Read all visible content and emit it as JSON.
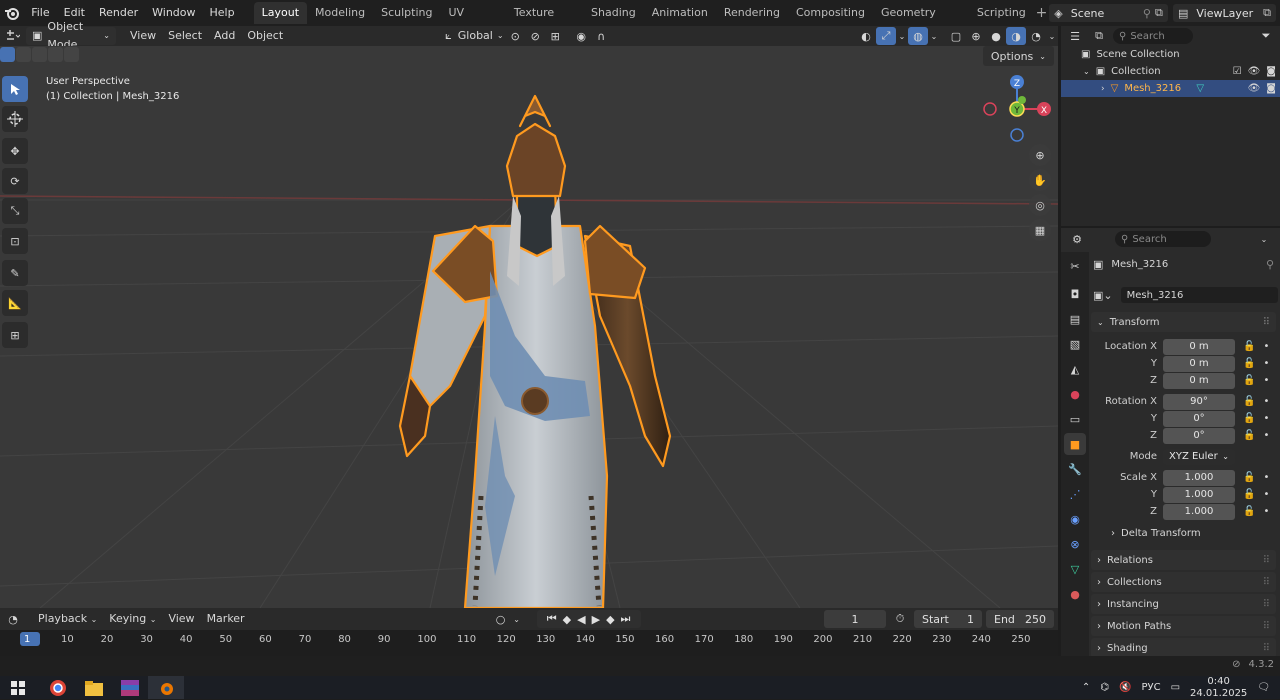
{
  "topbar": {
    "menus": [
      "File",
      "Edit",
      "Render",
      "Window",
      "Help"
    ],
    "workspaces": [
      "Layout",
      "Modeling",
      "Sculpting",
      "UV Editing",
      "Texture Paint",
      "Shading",
      "Animation",
      "Rendering",
      "Compositing",
      "Geometry Nodes",
      "Scripting"
    ],
    "active_workspace": "Layout",
    "scene": "Scene",
    "view_layer": "ViewLayer"
  },
  "viewport_header": {
    "mode": "Object Mode",
    "menus": [
      "View",
      "Select",
      "Add",
      "Object"
    ],
    "orientation": "Global",
    "options": "Options"
  },
  "viewport": {
    "perspective": "User Perspective",
    "collection_info": "(1) Collection | Mesh_3216",
    "axis_labels": [
      "Z",
      "Y",
      "X"
    ]
  },
  "timeline": {
    "menus": [
      "Playback",
      "Keying",
      "View",
      "Marker"
    ],
    "current_frame": "1",
    "start_label": "Start",
    "start": "1",
    "end_label": "End",
    "end": "250",
    "ruler": [
      "1",
      "10",
      "20",
      "30",
      "40",
      "50",
      "60",
      "70",
      "80",
      "90",
      "100",
      "110",
      "120",
      "130",
      "140",
      "150",
      "160",
      "170",
      "180",
      "190",
      "200",
      "210",
      "220",
      "230",
      "240",
      "250"
    ]
  },
  "outliner": {
    "search_placeholder": "Search",
    "items": [
      {
        "label": "Scene Collection"
      },
      {
        "label": "Collection"
      },
      {
        "label": "Mesh_3216"
      }
    ]
  },
  "properties": {
    "search_placeholder": "Search",
    "object_name": "Mesh_3216",
    "data_name": "Mesh_3216",
    "transform_title": "Transform",
    "location_label": "Location X",
    "location": [
      "0 m",
      "0 m",
      "0 m"
    ],
    "rotation_label": "Rotation X",
    "rotation": [
      "90°",
      "0°",
      "0°"
    ],
    "mode_label": "Mode",
    "mode": "XYZ Euler",
    "scale_label": "Scale X",
    "scale": [
      "1.000",
      "1.000",
      "1.000"
    ],
    "axis_y": "Y",
    "axis_z": "Z",
    "delta": "Delta Transform",
    "panels": [
      "Relations",
      "Collections",
      "Instancing",
      "Motion Paths",
      "Shading"
    ]
  },
  "status": {
    "version": "4.3.2"
  },
  "taskbar": {
    "lang": "РУС",
    "time": "0:40",
    "date": "24.01.2025"
  },
  "colors": {
    "accent": "#4772b3",
    "selection": "#ff9a1f",
    "viewport_bg": "#393939"
  }
}
